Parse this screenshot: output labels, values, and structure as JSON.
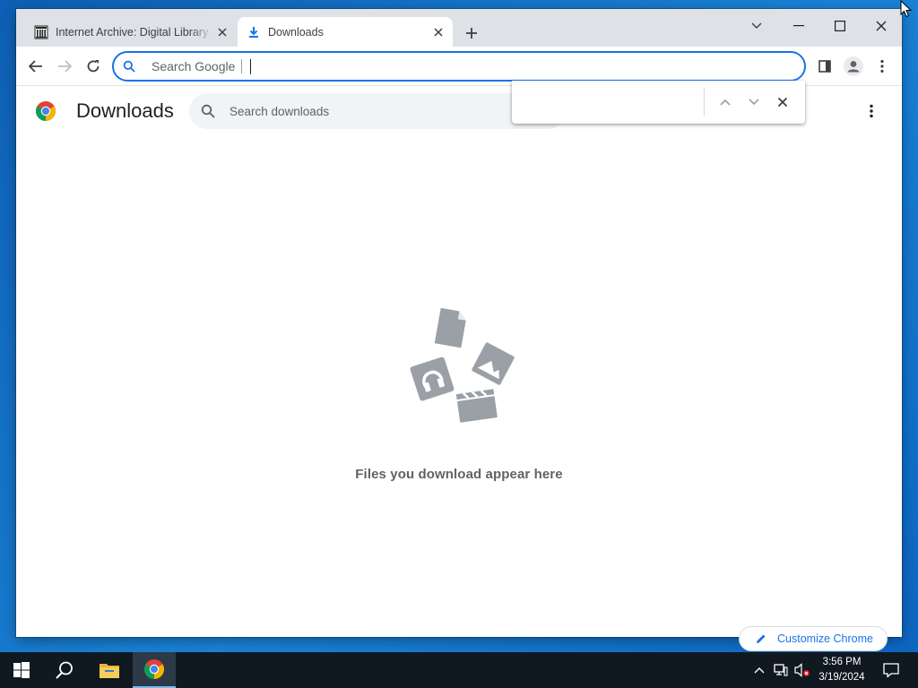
{
  "browser": {
    "tabs": [
      {
        "title": "Internet Archive: Digital Library of Free & Borrowable Books, Movies, Music & Wayback Machine",
        "favicon": "archive-icon",
        "active": false
      },
      {
        "title": "Downloads",
        "favicon": "download-icon",
        "active": true
      }
    ],
    "omnibox": {
      "placeholder": "Search Google",
      "value": ""
    },
    "accent": "#1a73e8"
  },
  "downloads": {
    "title": "Downloads",
    "search_placeholder": "Search downloads",
    "empty_message": "Files you download appear here"
  },
  "find_bar": {
    "value": ""
  },
  "footer": {
    "customize_label": "Customize Chrome"
  },
  "taskbar": {
    "time": "3:56 PM",
    "date": "3/19/2024"
  }
}
